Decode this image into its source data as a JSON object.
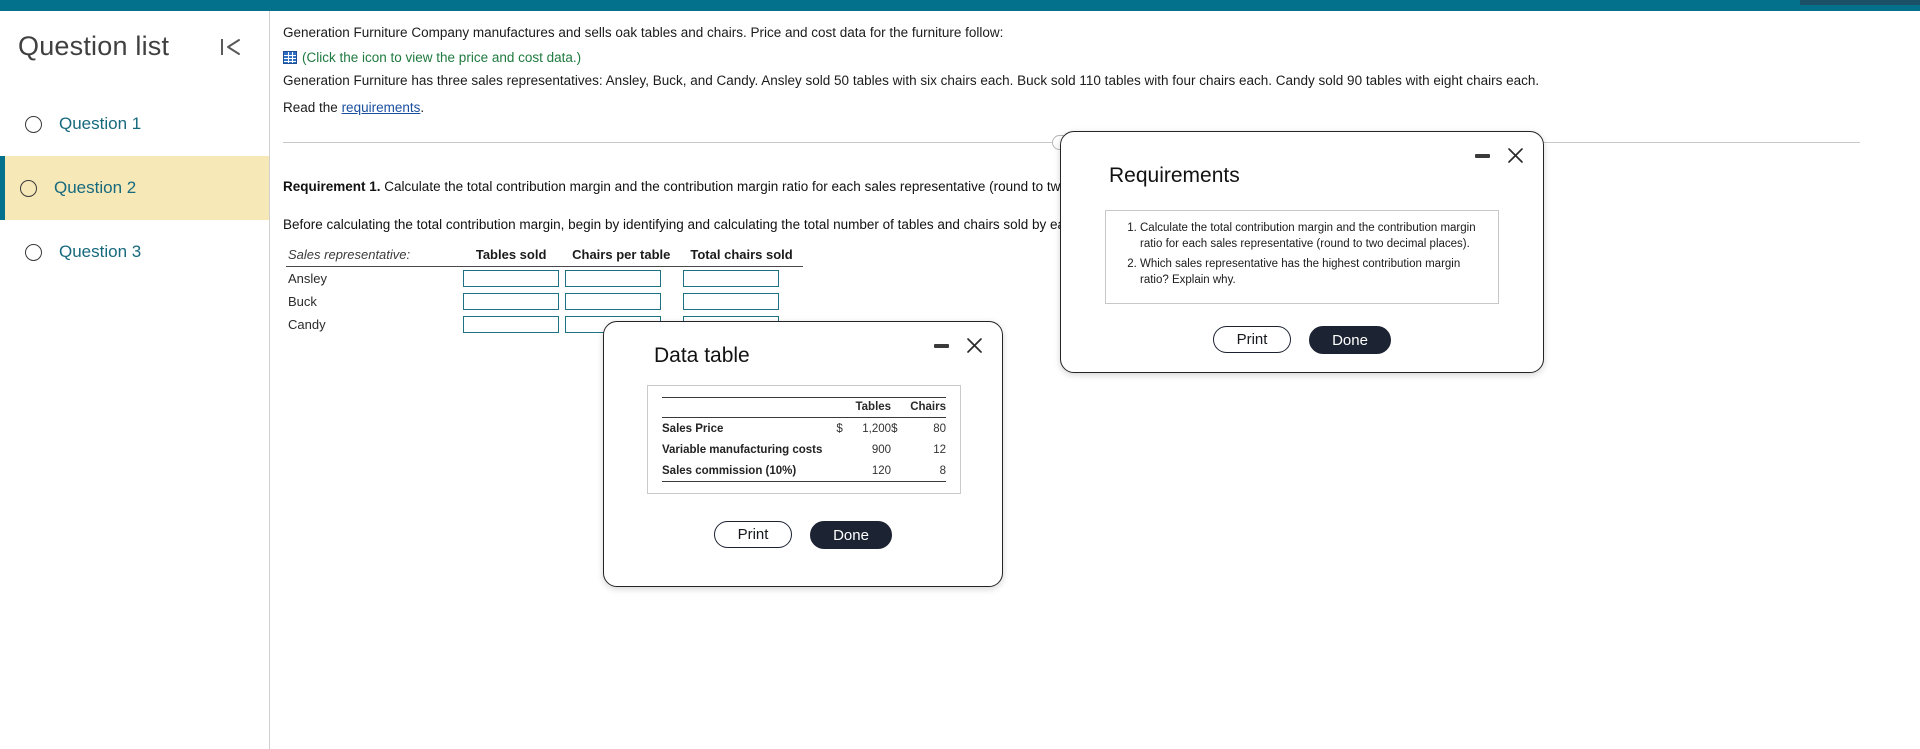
{
  "topbar": {
    "color": "#04718c"
  },
  "sidebar": {
    "title": "Question list",
    "collapse_icon": "collapse-left-icon",
    "items": [
      {
        "label": "Question 1",
        "active": false
      },
      {
        "label": "Question 2",
        "active": true
      },
      {
        "label": "Question 3",
        "active": false
      }
    ]
  },
  "problem": {
    "intro": "Generation Furniture Company manufactures and sells oak tables and chairs. Price and cost data for the furniture follow:",
    "icon_name": "data-table-grid-icon",
    "icon_caption": "(Click the icon to view the price and cost data.)",
    "details": "Generation Furniture has three sales representatives: Ansley, Buck, and Candy. Ansley sold 50 tables with six chairs each. Buck sold 110 tables with four chairs each. Candy sold 90 tables with eight chairs each.",
    "read_prefix": "Read the",
    "read_link": "requirements",
    "read_suffix": "."
  },
  "requirement": {
    "label": "Requirement 1.",
    "text": "Calculate the total contribution margin and the contribution margin ratio for each sales representative (round to two decimal places).",
    "subtext": "Before calculating the total contribution margin, begin by identifying and calculating the total number of tables and chairs sold by each sales representative for the period.",
    "table": {
      "headers": [
        "Sales representative:",
        "Tables sold",
        "Chairs per table",
        "Total chairs sold"
      ],
      "rows": [
        {
          "name": "Ansley",
          "tables_sold": "",
          "chairs_per_table": "",
          "total_chairs_sold": ""
        },
        {
          "name": "Buck",
          "tables_sold": "",
          "chairs_per_table": "",
          "total_chairs_sold": ""
        },
        {
          "name": "Candy",
          "tables_sold": "",
          "chairs_per_table": "",
          "total_chairs_sold": ""
        }
      ]
    }
  },
  "requirements_panel": {
    "title": "Requirements",
    "items": [
      "Calculate the total contribution margin and the contribution margin ratio for each sales representative (round to two decimal places).",
      "Which sales representative has the highest contribution margin ratio? Explain why."
    ],
    "print_label": "Print",
    "done_label": "Done",
    "minimize_icon": "minimize-icon",
    "close_icon": "close-icon"
  },
  "data_table_panel": {
    "title": "Data table",
    "columns": [
      "",
      "Tables",
      "Chairs"
    ],
    "rows": [
      {
        "label": "Sales Price",
        "tables_currency": "$",
        "tables": "1,200",
        "chairs_currency": "$",
        "chairs": "80"
      },
      {
        "label": "Variable manufacturing costs",
        "tables_currency": "",
        "tables": "900",
        "chairs_currency": "",
        "chairs": "12"
      },
      {
        "label": "Sales commission (10%)",
        "tables_currency": "",
        "tables": "120",
        "chairs_currency": "",
        "chairs": "8"
      }
    ],
    "print_label": "Print",
    "done_label": "Done",
    "minimize_icon": "minimize-icon",
    "close_icon": "close-icon"
  }
}
